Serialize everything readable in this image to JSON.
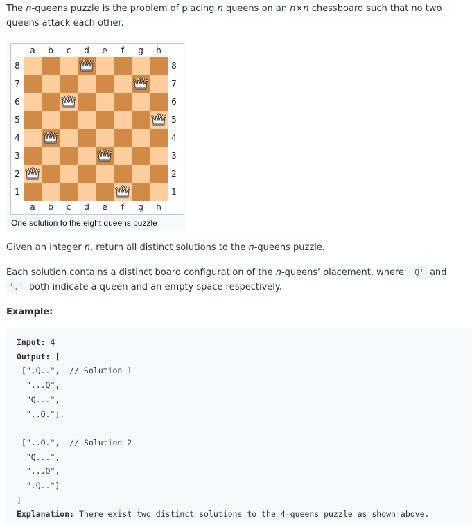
{
  "intro": {
    "t1": "The ",
    "n1": "n",
    "t2": "-queens puzzle is the problem of placing ",
    "n2": "n",
    "t3": " queens on an ",
    "nxn": "n×n",
    "t4": " chessboard such that no two queens attack each other."
  },
  "figure": {
    "files": [
      "a",
      "b",
      "c",
      "d",
      "e",
      "f",
      "g",
      "h"
    ],
    "ranks": [
      "8",
      "7",
      "6",
      "5",
      "4",
      "3",
      "2",
      "1"
    ],
    "queens": [
      "d8",
      "g7",
      "c6",
      "h5",
      "b4",
      "e3",
      "a2",
      "f1"
    ],
    "light_color": "#ffce9e",
    "dark_color": "#d18b47",
    "piece_icon": "white-queen-icon",
    "caption": "One solution to the eight queens puzzle"
  },
  "task": {
    "t1": "Given an integer ",
    "n": "n",
    "t2": ", return all distinct solutions to the ",
    "n2": "n",
    "t3": "-queens puzzle."
  },
  "format": {
    "t1": "Each solution contains a distinct board configuration of the ",
    "n": "n",
    "t2": "-queens' placement, where ",
    "q": "'Q'",
    "t3": " and ",
    "dot": "'.'",
    "t4": " both indicate a queen and an empty space respectively."
  },
  "example": {
    "heading": "Example:",
    "input_label": "Input:",
    "input_value": " 4",
    "output_label": "Output:",
    "output_open": " [",
    "lines": [
      " [\".Q..\",  // Solution 1",
      "  \"...Q\",",
      "  \"Q...\",",
      "  \"..Q.\"],",
      "",
      " [\"..Q.\",  // Solution 2",
      "  \"Q...\",",
      "  \"...Q\",",
      "  \".Q..\"]",
      "]"
    ],
    "explanation_label": "Explanation:",
    "explanation_value": " There exist two distinct solutions to the 4-queens puzzle as shown above."
  }
}
